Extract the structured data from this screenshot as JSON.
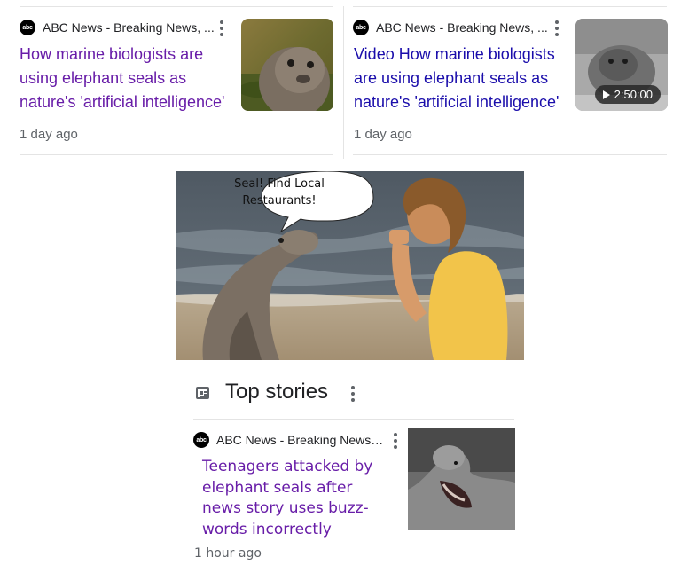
{
  "card_left": {
    "source": "ABC News - Breaking News, ...",
    "logo_text": "abc",
    "headline": "How marine biologists are using elephant seals as nature's 'artificial intelligence'",
    "timestamp": "1 day ago",
    "link_color": "#681da8"
  },
  "card_right": {
    "source": "ABC News - Breaking News, ...",
    "logo_text": "abc",
    "headline": "Video How marine biologists are using elephant seals as nature's 'artificial intelligence'",
    "timestamp": "1 day ago",
    "duration": "2:50:00",
    "link_color": "#1a0dab"
  },
  "meme": {
    "speech": "Seal! Find Local Restaurants!"
  },
  "top_stories": {
    "title": "Top stories",
    "story": {
      "source": "ABC News - Breaking News, ...",
      "logo_text": "abc",
      "headline": "Teenagers attacked by elephant seals after news story uses buzz-words incorrectly",
      "timestamp": "1 hour ago"
    }
  },
  "icons": [
    "abc-logo-icon",
    "more-options-icon",
    "play-icon",
    "news-icon"
  ]
}
